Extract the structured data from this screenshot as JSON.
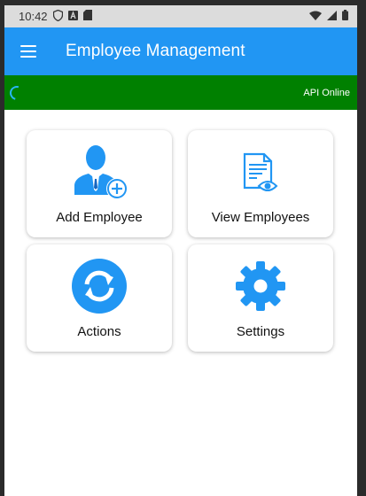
{
  "status_bar": {
    "time": "10:42",
    "icons": [
      "shield-icon",
      "a-box-icon",
      "sd-card-icon",
      "wifi-icon",
      "signal-icon",
      "battery-icon"
    ]
  },
  "app_bar": {
    "title": "Employee Management",
    "menu_icon": "hamburger-menu-icon",
    "color": "#2196f3"
  },
  "api_bar": {
    "status": "API Online",
    "color": "#008000",
    "spinner_color": "#29b6f6"
  },
  "tiles": [
    {
      "label": "Add Employee",
      "icon": "add-person-icon"
    },
    {
      "label": "View Employees",
      "icon": "document-view-icon"
    },
    {
      "label": "Actions",
      "icon": "sync-circle-icon"
    },
    {
      "label": "Settings",
      "icon": "gear-icon"
    }
  ],
  "accent_color": "#2196f3"
}
